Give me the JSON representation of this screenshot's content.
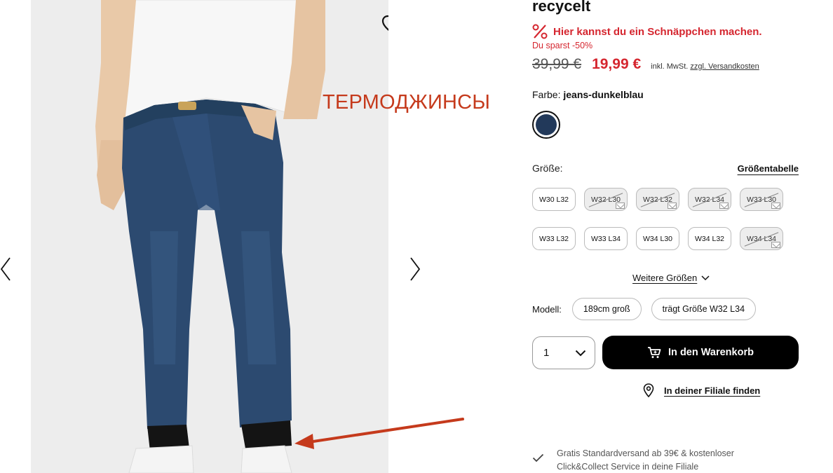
{
  "product": {
    "title": "recycelt",
    "deal_text": "Hier kannst du ein Schnäppchen machen.",
    "saving_text": "Du sparst -50%",
    "old_price": "39,99 €",
    "new_price": "19,99 €",
    "vat_note": "inkl. MwSt.",
    "shipping_link": "zzgl. Versandkosten"
  },
  "color": {
    "label": "Farbe:",
    "value": "jeans-dunkelblau",
    "swatch_hex": "#22395a"
  },
  "size": {
    "label": "Größe:",
    "table_link": "Größentabelle",
    "options": [
      {
        "label": "W30 L32",
        "available": true
      },
      {
        "label": "W32 L30",
        "available": false
      },
      {
        "label": "W32 L32",
        "available": false
      },
      {
        "label": "W32 L34",
        "available": false
      },
      {
        "label": "W33 L30",
        "available": false
      },
      {
        "label": "W33 L32",
        "available": true
      },
      {
        "label": "W33 L34",
        "available": true
      },
      {
        "label": "W34 L30",
        "available": true
      },
      {
        "label": "W34 L32",
        "available": true
      },
      {
        "label": "W34 L34",
        "available": false
      }
    ],
    "more_link": "Weitere Größen"
  },
  "model": {
    "label": "Modell:",
    "height": "189cm groß",
    "wears": "trägt Größe W32 L34"
  },
  "purchase": {
    "quantity": "1",
    "cart_button": "In den Warenkorb",
    "store_link": "In deiner Filiale finden"
  },
  "benefit": {
    "line1": "Gratis Standardversand ab 39€ & kostenloser",
    "line2": "Click&Collect Service in deine Filiale"
  },
  "annotation": {
    "label": "ТЕРМОДЖИНСЫ",
    "color": "#c53a1c"
  },
  "colors": {
    "sale_red": "#d5262f",
    "denim": "#2c4a70",
    "gallery_bg": "#ededed"
  }
}
